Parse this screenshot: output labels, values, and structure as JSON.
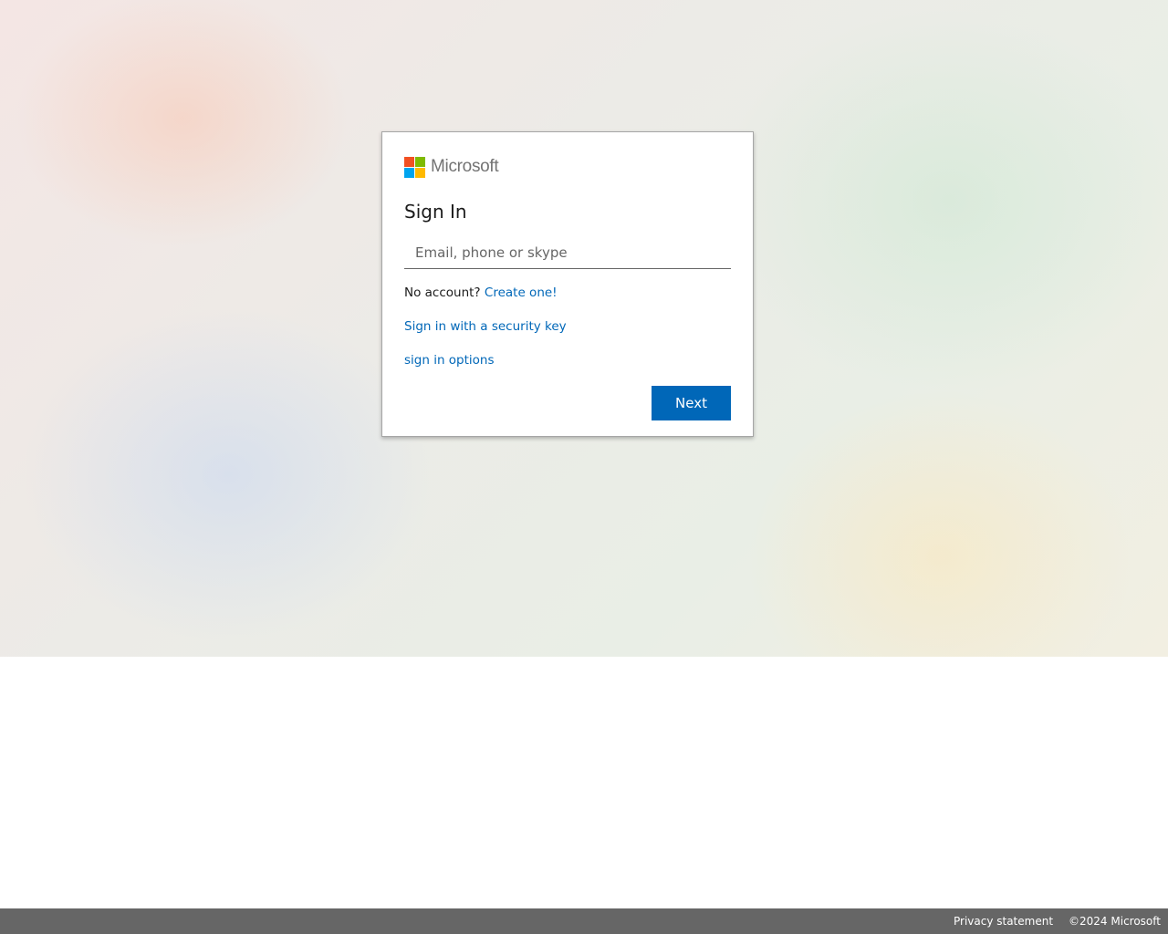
{
  "brand": {
    "name": "Microsoft",
    "logo_colors": [
      "#f25022",
      "#7fba00",
      "#00a4ef",
      "#ffb900"
    ]
  },
  "signin": {
    "title": "Sign In",
    "email_placeholder": "Email, phone or skype",
    "email_value": "",
    "no_account_text": "No account?",
    "create_link": "Create one!",
    "security_key_link": "Sign in with a security key",
    "options_link": "sign in options",
    "next_button": "Next"
  },
  "footer": {
    "privacy": "Privacy statement",
    "copyright": "©2024 Microsoft"
  },
  "colors": {
    "accent": "#0067b8",
    "footer_bg": "#666666"
  }
}
